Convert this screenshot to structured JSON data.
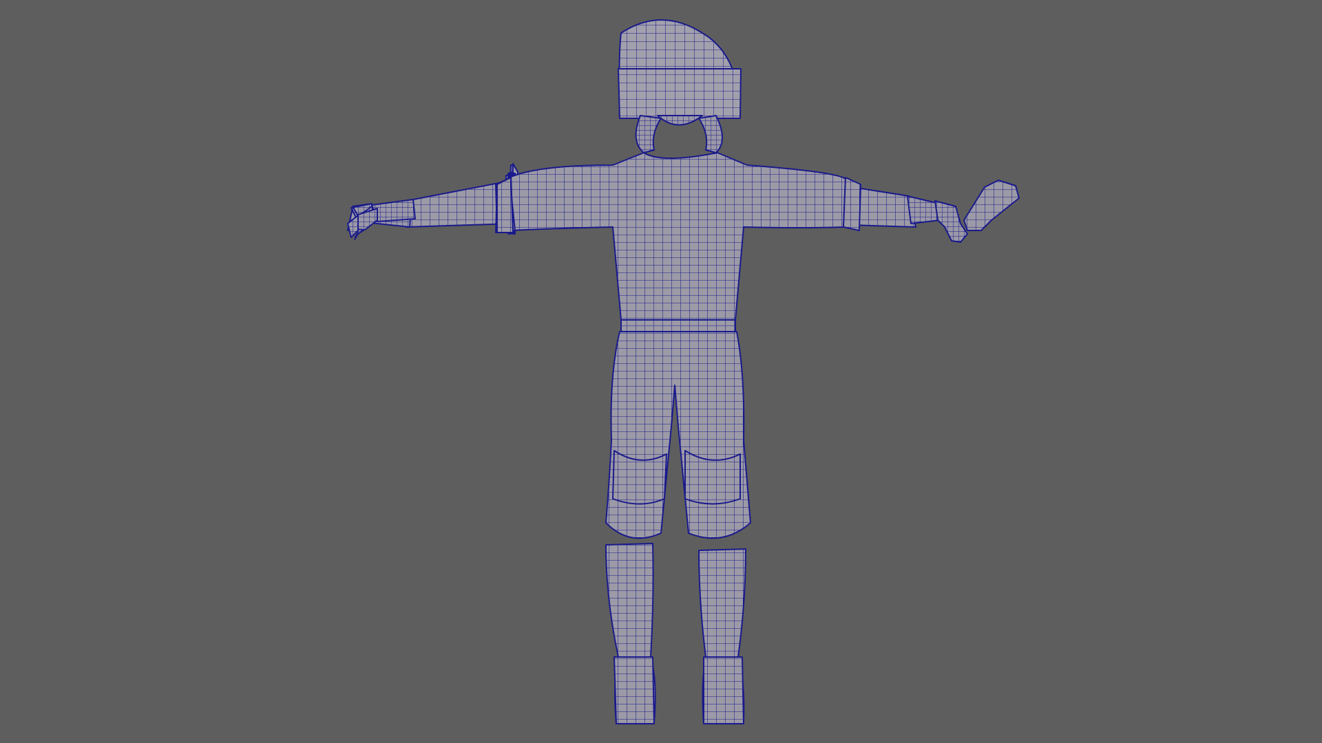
{
  "viewport": {
    "background_color": "#5e5e5e",
    "shading": "wireframe-on-shaded",
    "view": "back"
  },
  "model": {
    "pose": "T-pose",
    "surface_color": "#9c9aa6",
    "wire_color": "#1a1a8c",
    "parts": [
      "helmet",
      "hair",
      "neck",
      "torso",
      "sleeves",
      "arms",
      "hands",
      "handheld-object",
      "belt",
      "pants",
      "knee-pads",
      "boots"
    ]
  }
}
